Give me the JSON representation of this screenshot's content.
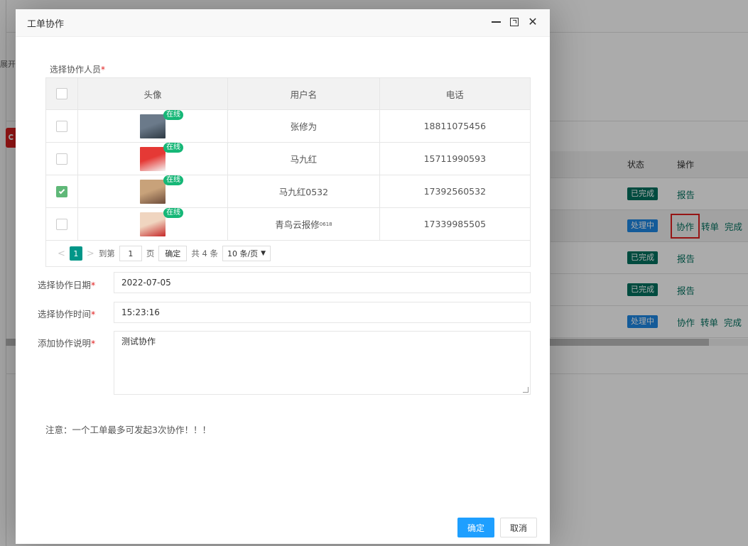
{
  "background": {
    "side_text": "展开",
    "table": {
      "headers": {
        "status": "状态",
        "ops": "操作"
      },
      "rows": [
        {
          "status": "已完成",
          "status_type": "done",
          "ops": [
            "报告"
          ]
        },
        {
          "status": "处理中",
          "status_type": "proc",
          "ops": [
            "协作",
            "转单",
            "完成"
          ],
          "highlighted": true
        },
        {
          "status": "已完成",
          "status_type": "done",
          "ops": [
            "报告"
          ]
        },
        {
          "status": "已完成",
          "status_type": "done",
          "ops": [
            "报告"
          ]
        },
        {
          "status": "处理中",
          "status_type": "proc",
          "ops": [
            "协作",
            "转单",
            "完成"
          ]
        }
      ]
    }
  },
  "modal": {
    "title": "工单协作",
    "select_users_label": "选择协作人员",
    "required_mark": "*",
    "table": {
      "headers": {
        "avatar": "头像",
        "username": "用户名",
        "phone": "电话"
      },
      "online_label": "在线",
      "rows": [
        {
          "username": "张修为",
          "suffix": "",
          "phone": "18811075456",
          "checked": false,
          "avatar_colors": [
            "#6b7a8a",
            "#2e3a44"
          ]
        },
        {
          "username": "马九红",
          "suffix": "",
          "phone": "15711990593",
          "checked": false,
          "avatar_colors": [
            "#e53935",
            "#f5f5f5"
          ]
        },
        {
          "username": "马九红0532",
          "suffix": "",
          "phone": "17392560532",
          "checked": true,
          "avatar_colors": [
            "#c8a27a",
            "#6d4c3a"
          ]
        },
        {
          "username": "青鸟云报修",
          "suffix": "0618",
          "phone": "17339985505",
          "checked": false,
          "avatar_colors": [
            "#f0d5c0",
            "#c62828"
          ]
        }
      ]
    },
    "pager": {
      "current": "1",
      "goto_label": "到第",
      "page_input": "1",
      "page_unit": "页",
      "confirm": "确定",
      "total": "共 4 条",
      "per_page": "10 条/页"
    },
    "date_label": "选择协作日期",
    "date_value": "2022-07-05",
    "time_label": "选择协作时间",
    "time_value": "15:23:16",
    "desc_label": "添加协作说明",
    "desc_value": "测试协作",
    "note": "注意：一个工单最多可发起3次协作！！！",
    "ok_button": "确定",
    "cancel_button": "取消"
  }
}
